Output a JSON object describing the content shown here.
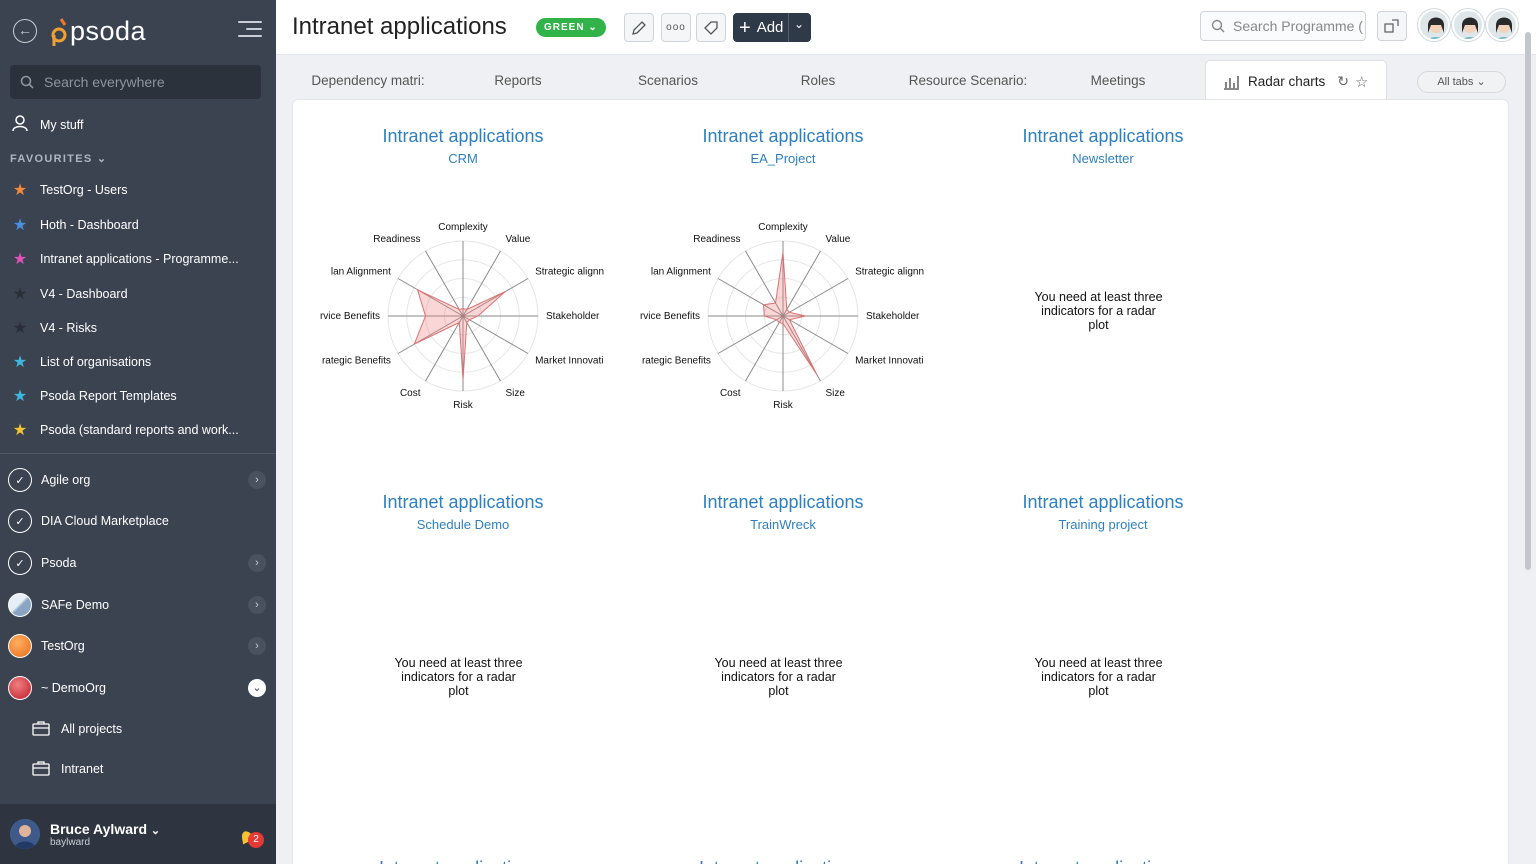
{
  "sidebar": {
    "logo_text": "psoda",
    "search_placeholder": "Search everywhere",
    "my_stuff": "My stuff",
    "favourites_label": "FAVOURITES",
    "favourites": [
      {
        "label": "TestOrg - Users",
        "color": "#f08a3c"
      },
      {
        "label": "Hoth - Dashboard",
        "color": "#4a8fe0"
      },
      {
        "label": "Intranet applications - Programme...",
        "color": "#e052b8"
      },
      {
        "label": "V4 - Dashboard",
        "color": "#2a2f37"
      },
      {
        "label": "V4 - Risks",
        "color": "#2a2f37"
      },
      {
        "label": "List of organisations",
        "color": "#3fb8e0"
      },
      {
        "label": "Psoda Report Templates",
        "color": "#3fb8e0"
      },
      {
        "label": "Psoda (standard reports and work...",
        "color": "#f5c230"
      }
    ],
    "orgs": [
      {
        "label": "Agile org",
        "expandable": true
      },
      {
        "label": "DIA Cloud Marketplace",
        "expandable": false
      },
      {
        "label": "Psoda",
        "expandable": true
      },
      {
        "label": "SAFe Demo",
        "expandable": true
      },
      {
        "label": "TestOrg",
        "expandable": true
      },
      {
        "label": "~ DemoOrg",
        "expandable": true,
        "open": true
      }
    ],
    "sub_items": [
      "All projects",
      "Intranet"
    ],
    "user": {
      "name": "Bruce Aylward",
      "username": "baylward",
      "notifications": "2"
    }
  },
  "header": {
    "title": "Intranet applications",
    "status": "GREEN",
    "add_label": "Add",
    "search_placeholder": "Search Programme (",
    "more_icon": "ooo"
  },
  "tabs": {
    "items": [
      "Dependency matri:",
      "Reports",
      "Scenarios",
      "Roles",
      "Resource Scenario:",
      "Meetings"
    ],
    "active": "Radar charts",
    "all_tabs": "All tabs"
  },
  "charts": [
    {
      "title": "Intranet applications",
      "subtitle": "CRM",
      "has_chart": true
    },
    {
      "title": "Intranet applications",
      "subtitle": "EA_Project",
      "has_chart": true
    },
    {
      "title": "Intranet applications",
      "subtitle": "Newsletter",
      "has_chart": false
    },
    {
      "title": "Intranet applications",
      "subtitle": "Schedule Demo",
      "has_chart": false
    },
    {
      "title": "Intranet applications",
      "subtitle": "TrainWreck",
      "has_chart": false
    },
    {
      "title": "Intranet applications",
      "subtitle": "Training project",
      "has_chart": false
    }
  ],
  "no_chart_message": [
    "You need at least three",
    "indicators for a radar",
    "plot"
  ],
  "chart_data": [
    {
      "type": "radar",
      "title": "Intranet applications",
      "subtitle": "CRM",
      "axes": [
        "Complexity",
        "Value",
        "Strategic alignn",
        "Stakeholder",
        "Market Innovati",
        "Size",
        "Risk",
        "Cost",
        "rategic Benefits",
        "rvice Benefits",
        "lan Alignment",
        "Readiness"
      ],
      "values": [
        0.1,
        0.1,
        0.65,
        0.2,
        0.1,
        0.1,
        0.85,
        0.1,
        0.75,
        0.5,
        0.7,
        0.1
      ],
      "range": [
        0,
        1
      ]
    },
    {
      "type": "radar",
      "title": "Intranet applications",
      "subtitle": "EA_Project",
      "axes": [
        "Complexity",
        "Value",
        "Strategic alignn",
        "Stakeholder",
        "Market Innovati",
        "Size",
        "Risk",
        "Cost",
        "rategic Benefits",
        "rvice Benefits",
        "lan Alignment",
        "Readiness"
      ],
      "values": [
        0.85,
        0.1,
        0.1,
        0.3,
        0.1,
        0.9,
        0.1,
        0.1,
        0.1,
        0.25,
        0.3,
        0.2
      ],
      "range": [
        0,
        1
      ]
    }
  ]
}
